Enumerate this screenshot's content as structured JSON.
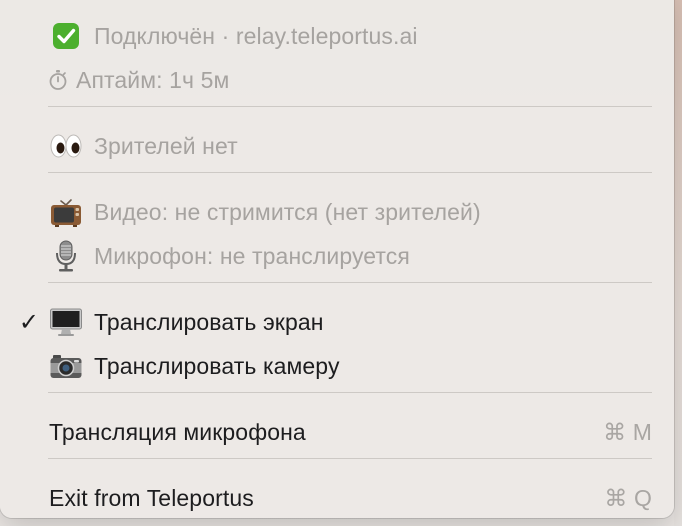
{
  "menu": {
    "status": {
      "connected": {
        "icon": "check-mark-button-icon",
        "label": "Подключён · relay.teleportus.ai"
      },
      "uptime": {
        "icon": "stopwatch-icon",
        "label": "Аптайм: 1ч 5м"
      }
    },
    "viewers": {
      "icon": "eyes-icon",
      "label": "Зрителей нет"
    },
    "media": {
      "video": {
        "icon": "television-icon",
        "label": "Видео: не стримится (нет зрителей)"
      },
      "mic": {
        "icon": "studio-microphone-icon",
        "label": "Микрофон: не транслируется"
      }
    },
    "sources": {
      "screen": {
        "checked": true,
        "check_glyph": "✓",
        "icon": "desktop-computer-icon",
        "label": "Транслировать экран"
      },
      "camera": {
        "checked": false,
        "icon": "camera-icon",
        "label": "Транслировать камеру"
      }
    },
    "mic_broadcast": {
      "label": "Трансляция микрофона",
      "shortcut": "⌘ M"
    },
    "exit": {
      "label": "Exit from Teleportus",
      "shortcut": "⌘ Q"
    }
  }
}
